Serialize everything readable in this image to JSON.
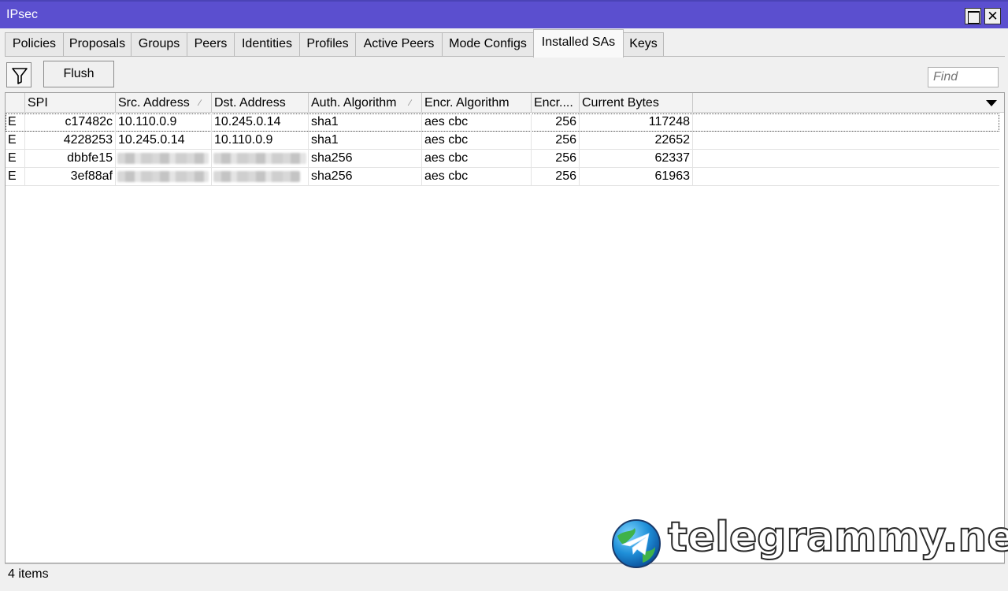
{
  "window": {
    "title": "IPsec"
  },
  "tabs": [
    {
      "label": "Policies"
    },
    {
      "label": "Proposals"
    },
    {
      "label": "Groups"
    },
    {
      "label": "Peers"
    },
    {
      "label": "Identities"
    },
    {
      "label": "Profiles"
    },
    {
      "label": "Active Peers"
    },
    {
      "label": "Mode Configs"
    },
    {
      "label": "Installed SAs"
    },
    {
      "label": "Keys"
    }
  ],
  "active_tab": "Installed SAs",
  "toolbar": {
    "filter_icon": "filter-icon",
    "flush_label": "Flush",
    "find_placeholder": "Find"
  },
  "table": {
    "columns": [
      "",
      "SPI",
      "Src. Address",
      "Dst. Address",
      "Auth. Algorithm",
      "Encr. Algorithm",
      "Encr....",
      "Current Bytes"
    ],
    "rows": [
      {
        "flag": "E",
        "spi": "c17482c",
        "src": "10.110.0.9",
        "dst": "10.245.0.14",
        "auth": "sha1",
        "encr": "aes cbc",
        "encr_key": "256",
        "bytes": "117248"
      },
      {
        "flag": "E",
        "spi": "4228253",
        "src": "10.245.0.14",
        "dst": "10.110.0.9",
        "auth": "sha1",
        "encr": "aes cbc",
        "encr_key": "256",
        "bytes": "22652"
      },
      {
        "flag": "E",
        "spi": "dbbfe15",
        "src": "",
        "dst": "",
        "auth": "sha256",
        "encr": "aes cbc",
        "encr_key": "256",
        "bytes": "62337"
      },
      {
        "flag": "E",
        "spi": "3ef88af",
        "src": "",
        "dst": "",
        "auth": "sha256",
        "encr": "aes cbc",
        "encr_key": "256",
        "bytes": "61963"
      }
    ]
  },
  "status": {
    "items_text": "4 items"
  },
  "watermark": {
    "text": "telegrammy.net"
  }
}
